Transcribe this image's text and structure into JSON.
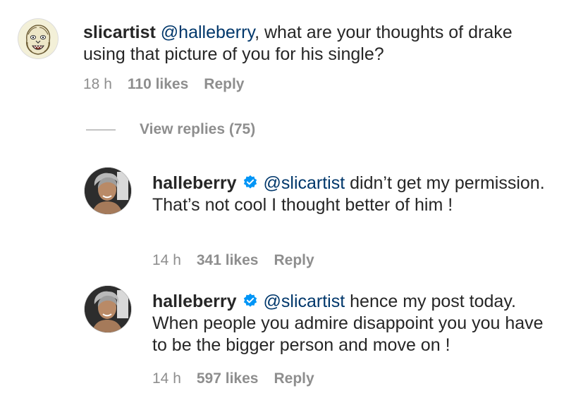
{
  "comment": {
    "username": "slicartist",
    "mention": "@halleberry",
    "text_after_mention": ", what are your thoughts of drake using that picture of you for his single?",
    "time": "18 h",
    "likes": "110 likes",
    "reply": "Reply"
  },
  "view_replies": "View replies (75)",
  "replies": [
    {
      "username": "halleberry",
      "mention": "@slicartist",
      "text_after_mention": " didn’t get my permission. That’s not cool I thought better of him !",
      "time": "14 h",
      "likes": "341 likes",
      "reply": "Reply"
    },
    {
      "username": "halleberry",
      "mention": "@slicartist",
      "text_after_mention": " hence my post today. When people you admire disappoint you you have to be the bigger person and move on !",
      "time": "14 h",
      "likes": "597 likes",
      "reply": "Reply"
    }
  ],
  "colors": {
    "verified": "#0095f6",
    "mention": "#00376b",
    "meta": "#8e8e8e",
    "text": "#262626"
  },
  "icons": {
    "verified": "verified-badge-icon"
  }
}
